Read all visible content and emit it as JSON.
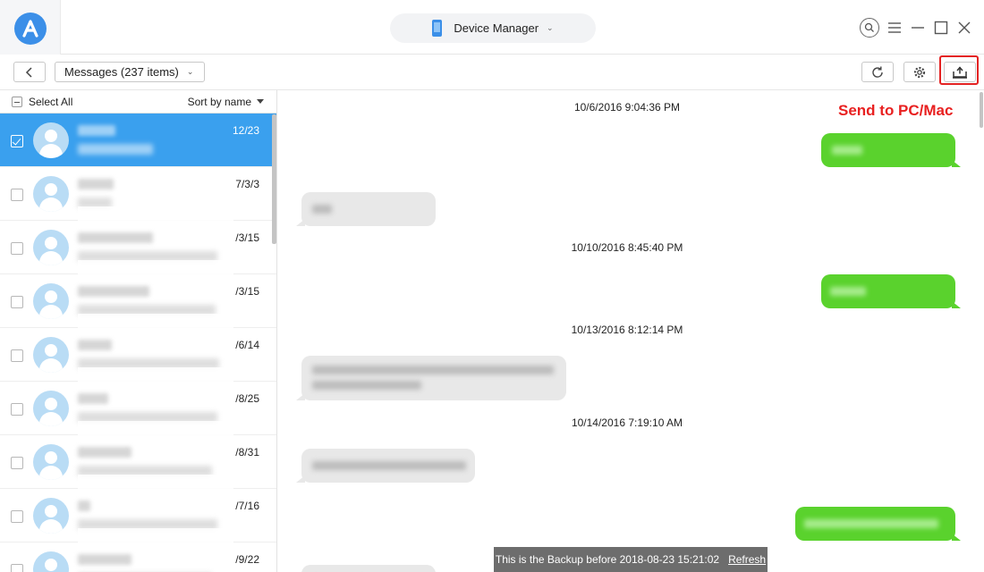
{
  "titlebar": {
    "device_label": "Device Manager",
    "window_controls": [
      "search-icon",
      "menu-icon",
      "minimize-icon",
      "maximize-icon",
      "close-icon"
    ]
  },
  "toolbar": {
    "category_label": "Messages (237 items)",
    "buttons": [
      "back-icon",
      "refresh-icon",
      "gear-icon",
      "send-to-pc-icon"
    ]
  },
  "callout": {
    "send_to_pc": "Send to PC/Mac"
  },
  "list": {
    "select_all": "Select All",
    "sort_label": "Sort by name",
    "contacts": [
      {
        "date": "12/23",
        "selected": true
      },
      {
        "date": "7/3/3",
        "selected": false
      },
      {
        "date": "/3/15",
        "selected": false
      },
      {
        "date": "/3/15",
        "selected": false
      },
      {
        "date": "/6/14",
        "selected": false
      },
      {
        "date": "/8/25",
        "selected": false
      },
      {
        "date": "/8/31",
        "selected": false
      },
      {
        "date": "/7/16",
        "selected": false
      },
      {
        "date": "/9/22",
        "selected": false
      }
    ]
  },
  "conversation": {
    "timestamps": [
      "10/6/2016 9:04:36 PM",
      "10/10/2016 8:45:40 PM",
      "10/13/2016 8:12:14 PM",
      "10/14/2016 7:19:10 AM"
    ]
  },
  "banner": {
    "text": "This is the Backup before 2018-08-23 15:21:02",
    "refresh": "Refresh"
  },
  "colors": {
    "accent": "#3aa0ee",
    "outgoing_bubble": "#5ad22d",
    "incoming_bubble": "#e8e8e8",
    "callout": "#e82020"
  }
}
